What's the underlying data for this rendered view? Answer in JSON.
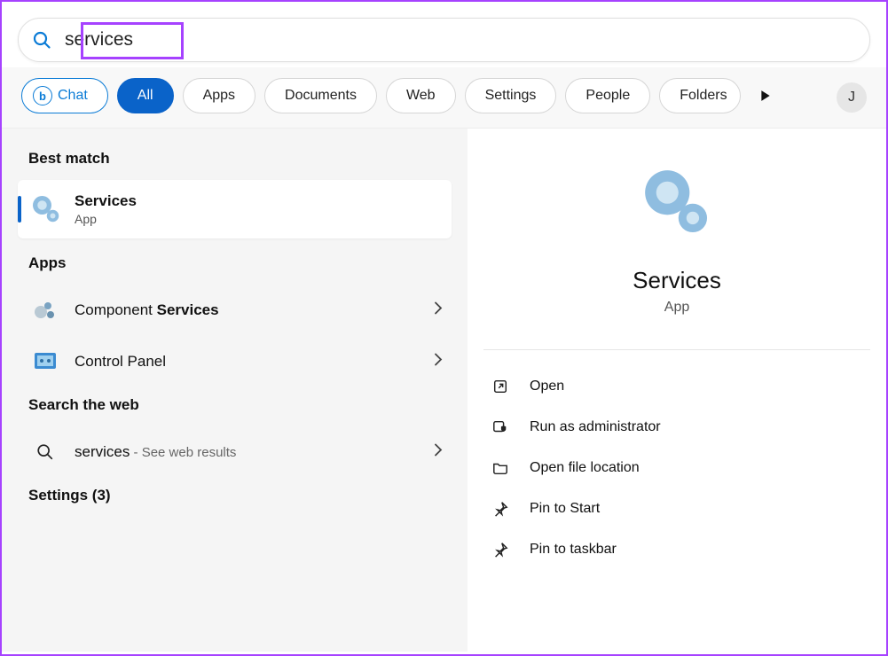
{
  "search": {
    "value": "services"
  },
  "filters": {
    "chat": "Chat",
    "items": [
      "All",
      "Apps",
      "Documents",
      "Web",
      "Settings",
      "People",
      "Folders"
    ],
    "active_index": 0
  },
  "user": {
    "initial": "J"
  },
  "left": {
    "best_match_label": "Best match",
    "best_match": {
      "title": "Services",
      "subtitle": "App"
    },
    "apps_label": "Apps",
    "apps": [
      {
        "prefix": "Component ",
        "bold": "Services"
      },
      {
        "label": "Control Panel"
      }
    ],
    "web_label": "Search the web",
    "web": {
      "term": "services",
      "suffix": " - See web results"
    },
    "settings_label": "Settings (3)"
  },
  "right": {
    "title": "Services",
    "subtitle": "App",
    "actions": [
      "Open",
      "Run as administrator",
      "Open file location",
      "Pin to Start",
      "Pin to taskbar"
    ]
  }
}
